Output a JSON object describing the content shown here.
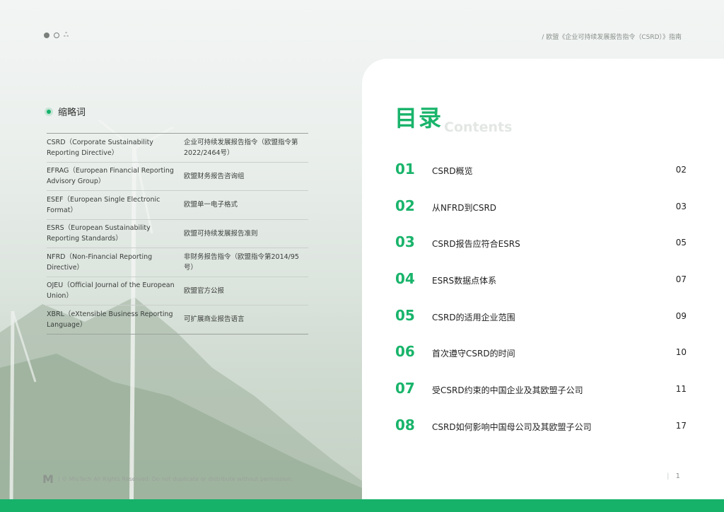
{
  "header": {
    "title": "/ 欧盟《企业可持续发展报告指令（CSRD）》指南"
  },
  "abbreviations": {
    "heading": "缩略词",
    "rows": [
      {
        "term": "CSRD（Corporate Sustainability Reporting Directive）",
        "meaning": "企业可持续发展报告指令（欧盟指令第2022/2464号）"
      },
      {
        "term": "EFRAG（European Financial Reporting Advisory Group）",
        "meaning": "欧盟财务报告咨询组"
      },
      {
        "term": "ESEF（European Single Electronic Format）",
        "meaning": "欧盟单一电子格式"
      },
      {
        "term": "ESRS（European Sustainability Reporting Standards）",
        "meaning": "欧盟可持续发展报告准则"
      },
      {
        "term": "NFRD（Non-Financial Reporting Directive）",
        "meaning": "非财务报告指令（欧盟指令第2014/95号）"
      },
      {
        "term": "OJEU（Official Journal of the European Union）",
        "meaning": "欧盟官方公报"
      },
      {
        "term": "XBRL（eXtensible Business Reporting Language）",
        "meaning": "可扩展商业报告语言"
      }
    ]
  },
  "toc": {
    "title_cn": "目录",
    "title_en": "Contents",
    "items": [
      {
        "num": "01",
        "label": "CSRD概览",
        "page": "02"
      },
      {
        "num": "02",
        "label": "从NFRD到CSRD",
        "page": "03"
      },
      {
        "num": "03",
        "label": "CSRD报告应符合ESRS",
        "page": "05"
      },
      {
        "num": "04",
        "label": "ESRS数据点体系",
        "page": "07"
      },
      {
        "num": "05",
        "label": "CSRD的适用企业范围",
        "page": "09"
      },
      {
        "num": "06",
        "label": "首次遵守CSRD的时间",
        "page": "10"
      },
      {
        "num": "07",
        "label": "受CSRD约束的中国企业及其欧盟子公司",
        "page": "11"
      },
      {
        "num": "08",
        "label": "CSRD如何影响中国母公司及其欧盟子公司",
        "page": "17"
      }
    ]
  },
  "footer": {
    "logo": "M",
    "copyright": "| © MioTech All Rights Reserved. Do not duplicate or distribute without permission.",
    "page_number": "1"
  },
  "colors": {
    "accent": "#16b26a",
    "card": "#ffffff"
  }
}
